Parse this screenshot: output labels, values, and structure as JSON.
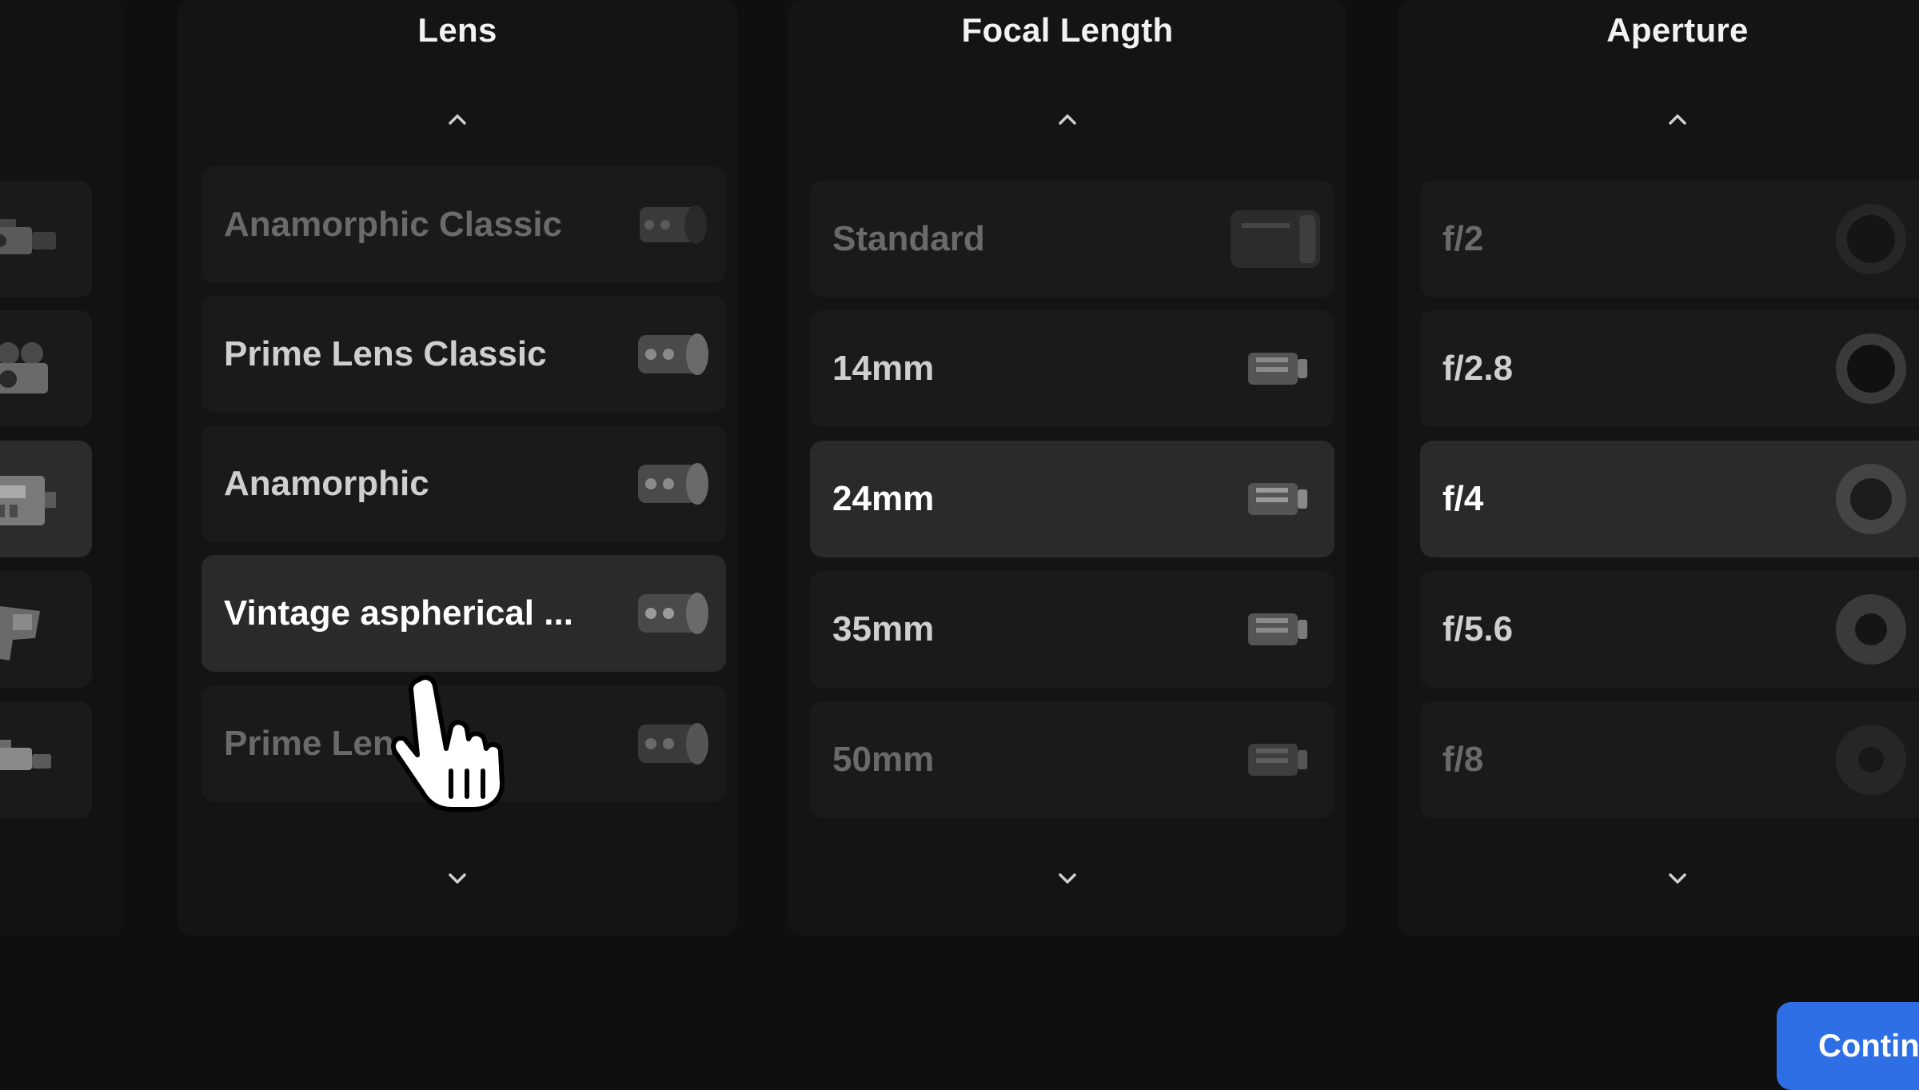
{
  "camera_strip": {
    "items": [
      {
        "icon": "video-camera-icon",
        "selected": false
      },
      {
        "icon": "film-camera-icon",
        "selected": false
      },
      {
        "icon": "cinema-camera-icon",
        "selected": true
      },
      {
        "icon": "handheld-camera-icon",
        "selected": false
      },
      {
        "icon": "camcorder-icon",
        "selected": false
      }
    ]
  },
  "columns": {
    "lens": {
      "header": "Lens",
      "items": [
        {
          "label": "Anamorphic Classic",
          "state": "dim"
        },
        {
          "label": "Prime Lens Classic",
          "state": "normal"
        },
        {
          "label": "Anamorphic",
          "state": "normal"
        },
        {
          "label": "Vintage aspherical ...",
          "state": "selected"
        },
        {
          "label": "Prime Len",
          "state": "dim"
        }
      ]
    },
    "focal_length": {
      "header": "Focal Length",
      "items": [
        {
          "label": "Standard",
          "state": "dim"
        },
        {
          "label": "14mm",
          "state": "normal"
        },
        {
          "label": "24mm",
          "state": "selected"
        },
        {
          "label": "35mm",
          "state": "normal"
        },
        {
          "label": "50mm",
          "state": "dim"
        }
      ]
    },
    "aperture": {
      "header": "Aperture",
      "items": [
        {
          "label": "f/2",
          "state": "dim"
        },
        {
          "label": "f/2.8",
          "state": "normal"
        },
        {
          "label": "f/4",
          "state": "selected"
        },
        {
          "label": "f/5.6",
          "state": "normal"
        },
        {
          "label": "f/8",
          "state": "dim"
        }
      ]
    }
  },
  "footer": {
    "continue_label": "Continu"
  },
  "colors": {
    "background": "#0f0f0f",
    "panel": "#141414",
    "item": "#1a1a1a",
    "item_selected": "#2a2a2a",
    "accent": "#2f6fe6"
  }
}
